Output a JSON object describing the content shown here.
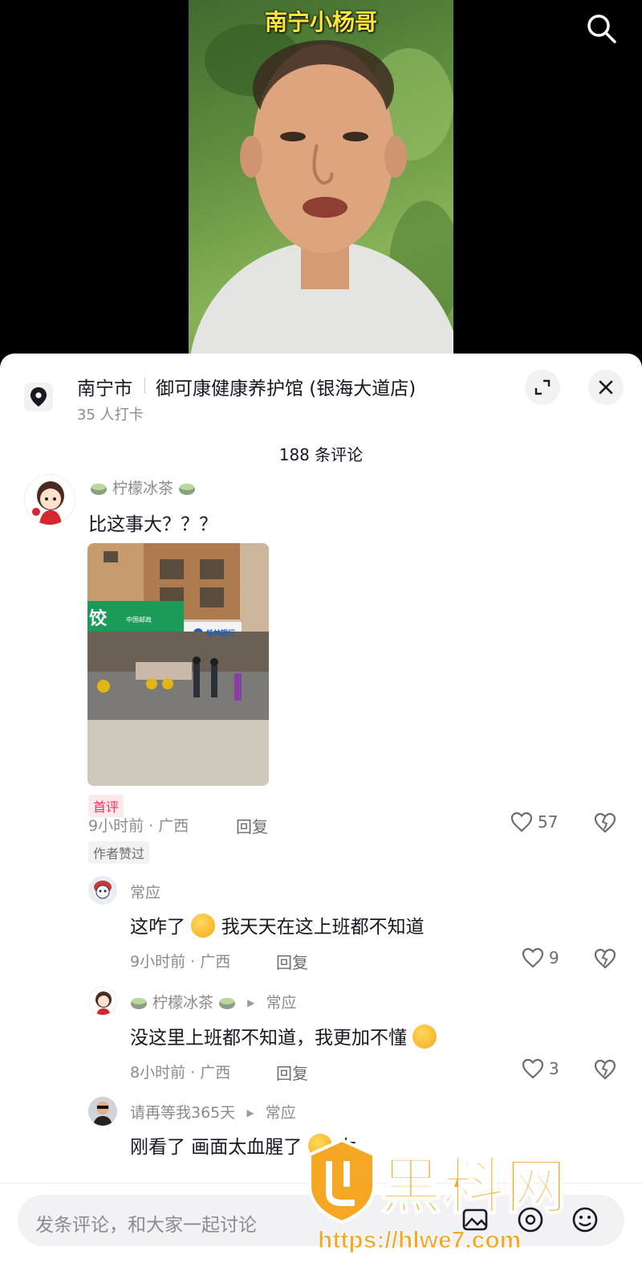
{
  "video": {
    "title": "南宁小杨哥",
    "search_icon": "search-icon"
  },
  "location": {
    "city": "南宁市",
    "shop": "御可康健康养护馆 (银海大道店)",
    "checkins": "35 人打卡",
    "pin_icon": "location-pin-icon"
  },
  "comments_header": {
    "count_label": "188 条评论"
  },
  "comments": [
    {
      "name": "柠檬冰茶",
      "text": "比这事大？？？",
      "photo_caption_shop": "中国邮政",
      "photo_sign_bank": "桂林银行",
      "photo_sign_left": "饺",
      "first_tag": "首评",
      "time": "9小时前 · 广西",
      "reply": "回复",
      "likes": "57",
      "author_liked": "作者赞过"
    }
  ],
  "replies": [
    {
      "name": "常应",
      "text": "这咋了",
      "text_after": "我天天在这上班都不知道",
      "time": "9小时前 · 广西",
      "reply": "回复",
      "likes": "9"
    },
    {
      "name": "柠檬冰茶",
      "reply_to": "常应",
      "text": "没这里上班都不知道，我更加不懂",
      "time": "8小时前 · 广西",
      "reply": "回复",
      "likes": "3"
    },
    {
      "name": "请再等我365天",
      "reply_to": "常应",
      "text": "刚看了 画面太血腥了",
      "text_after": "女"
    }
  ],
  "input": {
    "placeholder": "发条评论，和大家一起讨论"
  },
  "watermark": {
    "text": "黑料网",
    "url": "https://hlwe7.com"
  },
  "colors": {
    "first_tag_bg": "#fde8ec",
    "first_tag_fg": "#fe2c55",
    "watermark": "#f5a623"
  }
}
